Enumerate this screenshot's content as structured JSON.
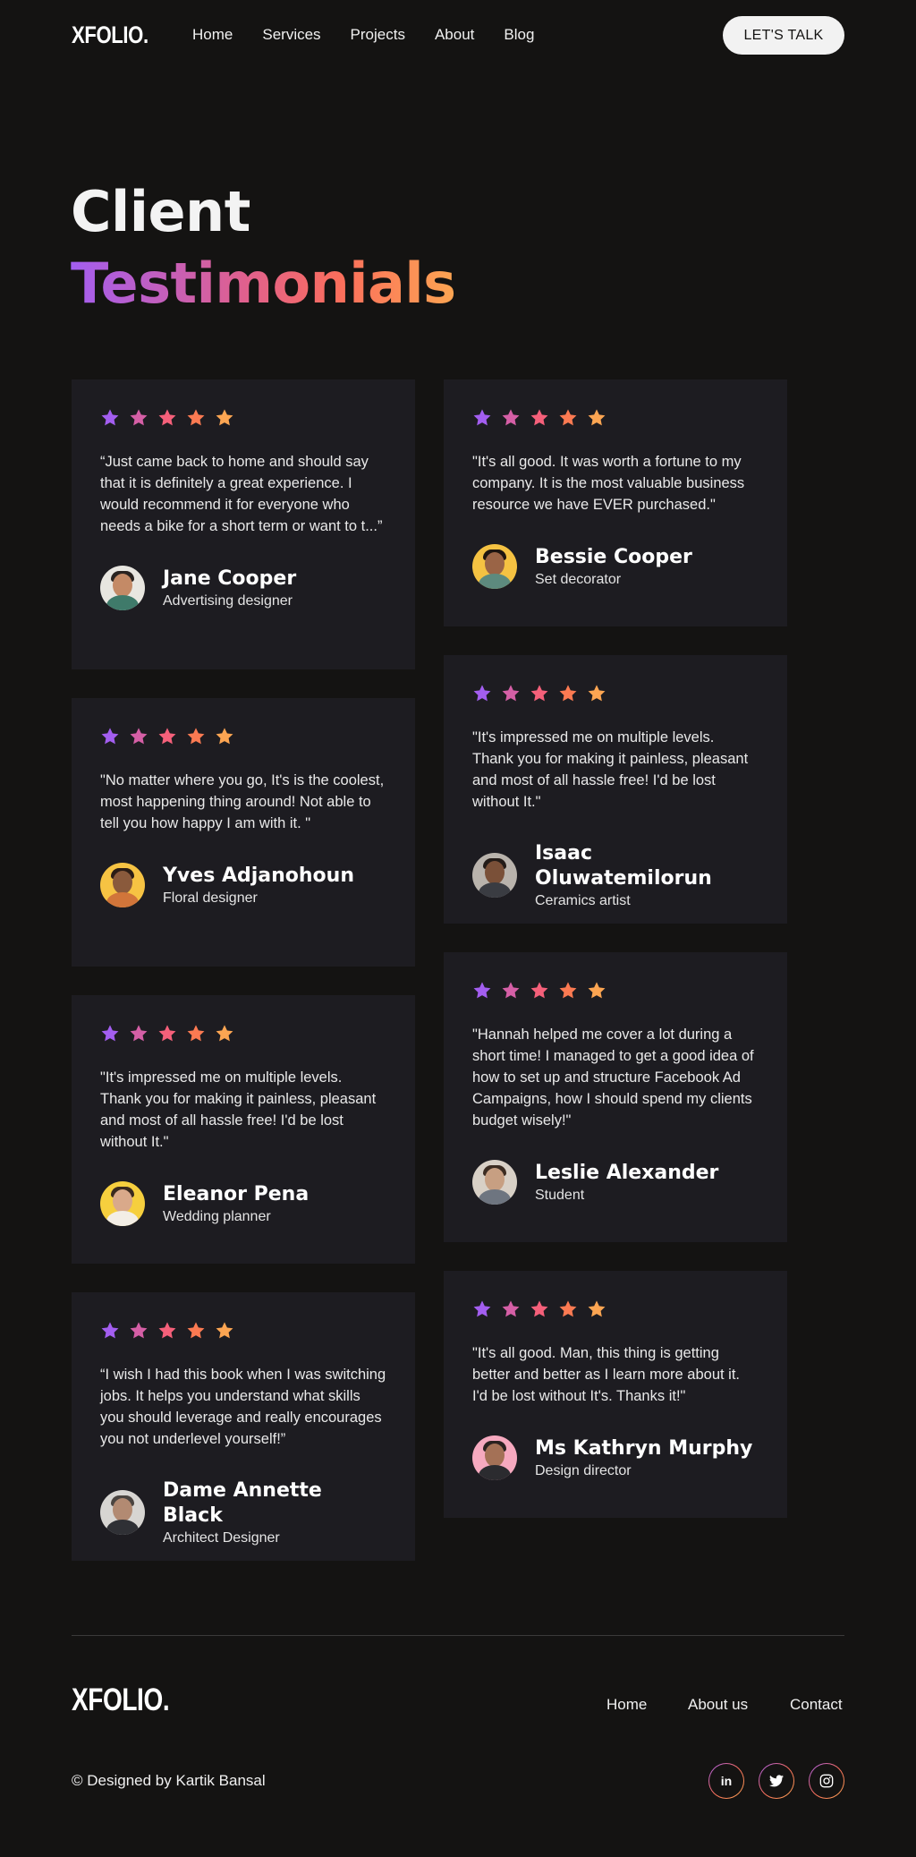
{
  "header": {
    "logo": "XFOLIO.",
    "nav": [
      "Home",
      "Services",
      "Projects",
      "About",
      "Blog"
    ],
    "cta": "LET'S TALK"
  },
  "hero": {
    "line1": "Client",
    "line2": "Testimonials"
  },
  "colors": {
    "background": "#141312",
    "card": "#1d1c21",
    "gradient": [
      "#a35ef0",
      "#e0608e",
      "#fb6e5c",
      "#fca552"
    ]
  },
  "testimonials": [
    {
      "rating": 5,
      "quote": "“Just came back to home and should say that it is definitely a great experience. I would recommend it for everyone who needs a bike for a short term or want to t...”",
      "name": "Jane Cooper",
      "role": "Advertising designer"
    },
    {
      "rating": 5,
      "quote": "\"It's all good. It was worth a fortune to my company. It is the most valuable business resource we have EVER purchased.\"",
      "name": "Bessie Cooper",
      "role": "Set decorator"
    },
    {
      "rating": 5,
      "quote": "\"No matter where you go, It's is the coolest, most happening thing around! Not able to tell you how happy I am with it. \"",
      "name": "Yves Adjanohoun",
      "role": "Floral designer"
    },
    {
      "rating": 5,
      "quote": "\"It's impressed me on multiple levels. Thank you for making it painless, pleasant and most of all hassle free! I'd be lost without It.\"",
      "name": "Isaac Oluwatemilorun",
      "role": "Ceramics artist"
    },
    {
      "rating": 5,
      "quote": "\"It's impressed me on multiple levels. Thank you for making it painless, pleasant and most of all hassle free! I'd be lost without It.\"",
      "name": "Eleanor Pena",
      "role": "Wedding planner"
    },
    {
      "rating": 5,
      "quote": "\"Hannah helped me cover a lot during a short time! I managed to get a good idea of how to set up and structure Facebook Ad Campaigns, how I should spend my clients budget wisely!\"",
      "name": "Leslie Alexander",
      "role": "Student"
    },
    {
      "rating": 5,
      "quote": "“I wish I had this book when I was switching jobs. It helps you understand what skills you should leverage and really encourages you not underlevel yourself!”",
      "name": "Dame Annette Black",
      "role": "Architect Designer"
    },
    {
      "rating": 5,
      "quote": "\"It's all good. Man, this thing is getting better and better as I learn more about it. I'd be lost without It's. Thanks it!\"",
      "name": "Ms Kathryn Murphy",
      "role": "Design director"
    }
  ],
  "footer": {
    "logo": "XFOLIO.",
    "nav": [
      "Home",
      "About us",
      "Contact"
    ],
    "copyright": "© Designed by Kartik Bansal",
    "social_icons": [
      "linkedin-icon",
      "twitter-icon",
      "instagram-icon"
    ],
    "social_labels": [
      "in"
    ]
  }
}
